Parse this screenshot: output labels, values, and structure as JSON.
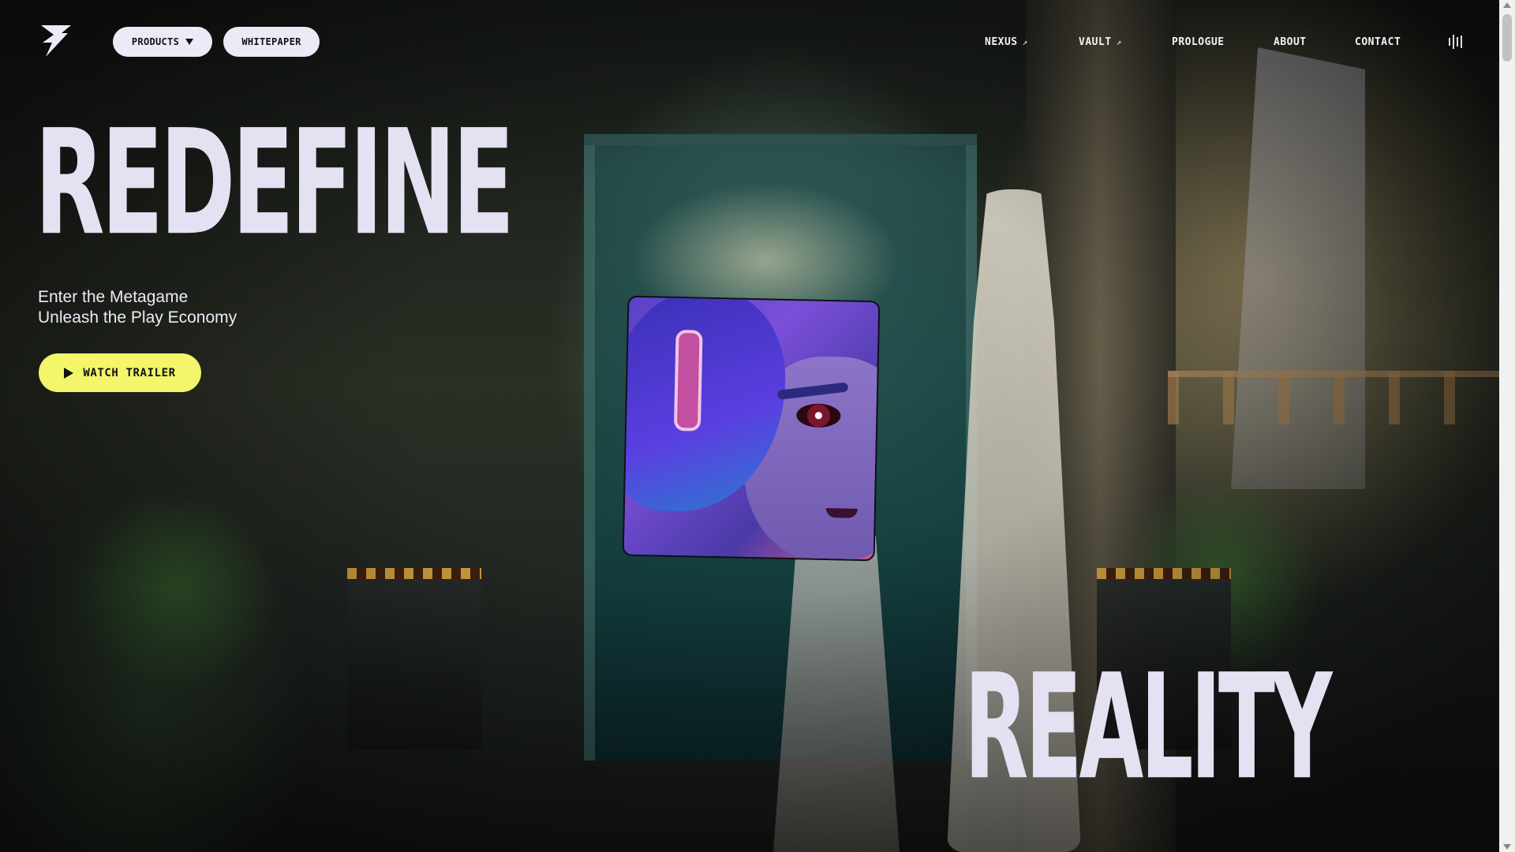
{
  "header": {
    "logo_icon": "lightning-bolt-logo",
    "products_label": "PRODUCTS",
    "whitepaper_label": "WHITEPAPER",
    "nav": [
      {
        "label": "NEXUS",
        "external": true
      },
      {
        "label": "VAULT",
        "external": true
      },
      {
        "label": "PROLOGUE",
        "external": false
      },
      {
        "label": "ABOUT",
        "external": false
      },
      {
        "label": "CONTACT",
        "external": false
      }
    ],
    "nav_arrow": "↗",
    "audio_icon": "sound-bars-icon"
  },
  "hero": {
    "word_top": "REDEFINE",
    "word_bottom": "REALITY",
    "tagline_line1": "Enter the Metagame",
    "tagline_line2": "Unleash the Play Economy",
    "trailer_label": "WATCH TRAILER"
  },
  "colors": {
    "hero_text": "#e3e1f2",
    "pill_bg": "#eceaf6",
    "accent_yellow": "#f3f56a"
  }
}
